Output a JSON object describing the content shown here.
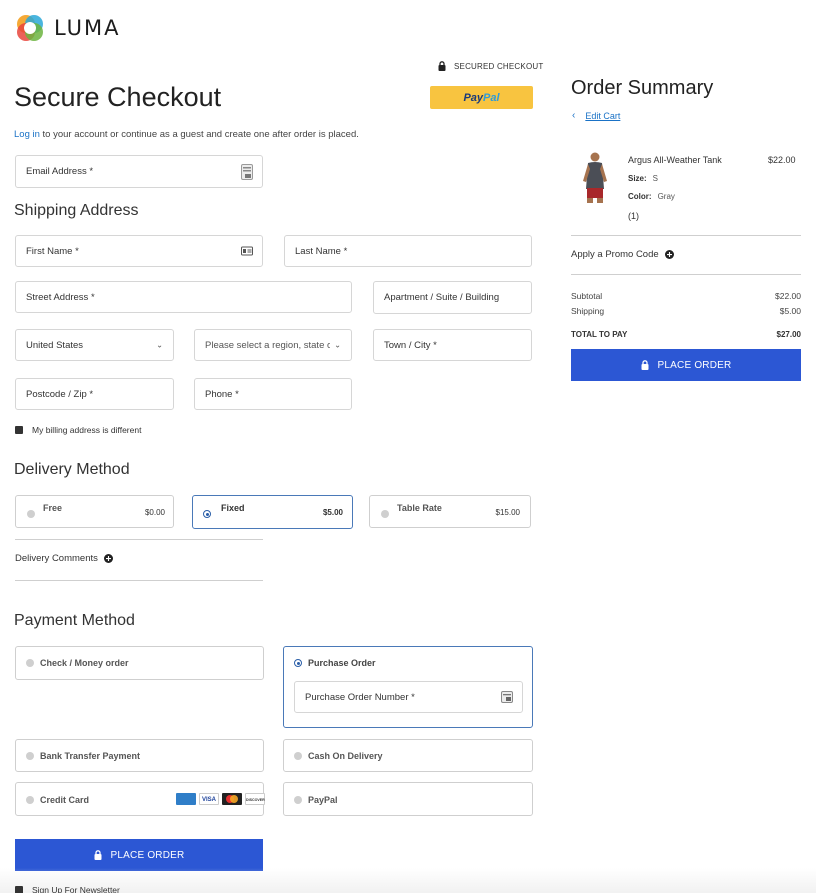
{
  "brand": {
    "name": "LUMA"
  },
  "header": {
    "secured_label": "SECURED CHECKOUT",
    "title": "Secure Checkout",
    "paypal_part1": "Pay",
    "paypal_part2": "Pal"
  },
  "login": {
    "link_text": "Log in",
    "rest_text": " to your account or continue as a guest and create one after order is placed."
  },
  "fields": {
    "email": "Email Address *",
    "first_name": "First Name *",
    "last_name": "Last Name *",
    "street": "Street Address *",
    "apartment": "Apartment / Suite / Building",
    "country": "United States",
    "region": "Please select a region, state or province",
    "town": "Town / City *",
    "postcode": "Postcode / Zip *",
    "phone": "Phone *"
  },
  "shipping": {
    "heading": "Shipping Address",
    "billing_checkbox": "My billing address is different"
  },
  "delivery": {
    "heading": "Delivery Method",
    "options": [
      {
        "label": "Free",
        "price": "$0.00",
        "selected": false
      },
      {
        "label": "Fixed",
        "price": "$5.00",
        "selected": true
      },
      {
        "label": "Table Rate",
        "price": "$15.00",
        "selected": false
      }
    ],
    "comments_label": "Delivery Comments"
  },
  "payment": {
    "heading": "Payment Method",
    "check_money": "Check / Money order",
    "purchase_order": "Purchase Order",
    "po_number": "Purchase Order Number *",
    "bank_transfer": "Bank Transfer Payment",
    "cash_on_delivery": "Cash On Delivery",
    "credit_card": "Credit Card",
    "paypal": "PayPal",
    "card_brands": {
      "visa": "VISA",
      "discover": "DISCOVER"
    }
  },
  "place_order_label": "PLACE ORDER",
  "newsletter_label": "Sign Up For Newsletter",
  "summary": {
    "title": "Order Summary",
    "edit_cart": "Edit Cart",
    "product": {
      "name": "Argus All-Weather Tank",
      "price": "$22.00",
      "size_label": "Size:",
      "size_value": "S",
      "color_label": "Color:",
      "color_value": "Gray",
      "qty": "(1)"
    },
    "promo_label": "Apply a Promo Code",
    "subtotal_label": "Subtotal",
    "subtotal_value": "$22.00",
    "shipping_label": "Shipping",
    "shipping_value": "$5.00",
    "total_label": "TOTAL TO PAY",
    "total_value": "$27.00",
    "place_order_label": "PLACE ORDER"
  },
  "colors": {
    "primary": "#2c57d4",
    "link": "#1a72c6",
    "paypal_yellow": "#f8c440",
    "selected_border": "#4a79b8"
  }
}
